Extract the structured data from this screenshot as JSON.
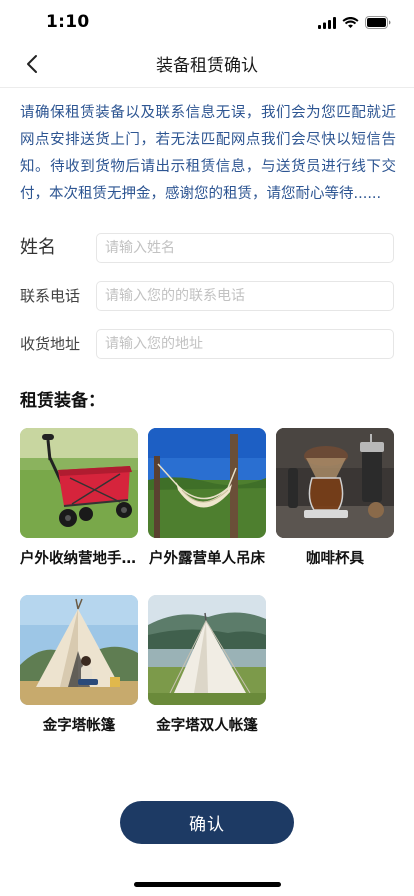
{
  "status_bar": {
    "time": "1:10"
  },
  "nav": {
    "title": "装备租赁确认"
  },
  "notice": "请确保租赁装备以及联系信息无误，我们会为您匹配就近网点安排送货上门，若无法匹配网点我们会尽快以短信告知。待收到货物后请出示租赁信息，与送货员进行线下交付，本次租赁无押金，感谢您的租赁，请您耐心等待......",
  "form": {
    "name": {
      "label": "姓名",
      "placeholder": "请输入姓名",
      "value": ""
    },
    "phone": {
      "label": "联系电话",
      "placeholder": "请输入您的的联系电话",
      "value": ""
    },
    "address": {
      "label": "收货地址",
      "placeholder": "请输入您的地址",
      "value": ""
    }
  },
  "equipment": {
    "title": "租赁装备：",
    "items": [
      {
        "name": "户外收纳营地手推车",
        "image": "red-folding-wagon-on-grass"
      },
      {
        "name": "户外露营单人吊床",
        "image": "hammock-between-trees"
      },
      {
        "name": "咖啡杯具",
        "image": "coffee-set-on-table"
      },
      {
        "name": "金字塔帐篷",
        "image": "pyramid-tent-with-person"
      },
      {
        "name": "金字塔双人帐篷",
        "image": "pyramid-tent-by-lake"
      }
    ]
  },
  "confirm_button": {
    "label": "确认"
  },
  "colors": {
    "notice_text": "#2d5592",
    "button_bg": "#1d3a64"
  }
}
